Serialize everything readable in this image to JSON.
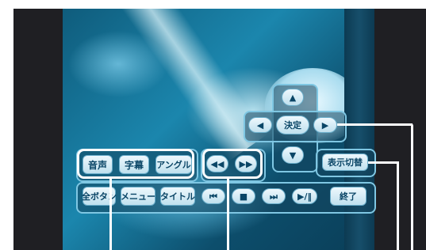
{
  "audio_group": {
    "audio_label": "音声",
    "subtitle_label": "字幕",
    "angle_label": "アングル"
  },
  "seek_group": {
    "rewind_icon": "rewind-icon",
    "fast_forward_icon": "fast-forward-icon"
  },
  "direction_pad": {
    "up_icon": "arrow-up-icon",
    "down_icon": "arrow-down-icon",
    "left_icon": "arrow-left-icon",
    "right_icon": "arrow-right-icon",
    "enter_label": "決定"
  },
  "display_toggle_label": "表示切替",
  "bottom_bar": {
    "all_buttons_label": "全ボタン",
    "menu_label": "メニュー",
    "title_label": "タイトル",
    "prev_icon": "skip-back-icon",
    "stop_icon": "stop-icon",
    "next_icon": "skip-forward-icon",
    "play_pause_icon": "play-pause-icon",
    "exit_label": "終了"
  },
  "colors": {
    "callout_line": "#ffffff",
    "button_text": "#0a4566",
    "panel_border": "#7fc7e3"
  }
}
